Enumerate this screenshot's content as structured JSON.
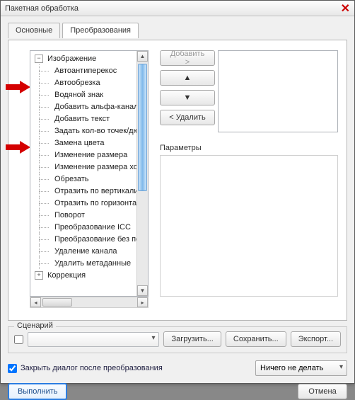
{
  "window": {
    "title": "Пакетная обработка"
  },
  "tabs": {
    "basic": "Основные",
    "transforms": "Преобразования"
  },
  "tree": {
    "group_image": "Изображение",
    "items": [
      "Автоантиперекос",
      "Автообрезка",
      "Водяной знак",
      "Добавить альфа-канал",
      "Добавить текст",
      "Задать кол-во точек/дюйм",
      "Замена цвета",
      "Изменение размера",
      "Изменение размера холста",
      "Обрезать",
      "Отразить по вертикали",
      "Отразить по горизонтали",
      "Поворот",
      "Преобразование ICC",
      "Преобразование без потерь",
      "Удаление канала",
      "Удалить метаданные"
    ],
    "group_correction": "Коррекция"
  },
  "buttons": {
    "add": "Добавить >",
    "delete": "< Удалить"
  },
  "params_label": "Параметры",
  "scenario": {
    "legend": "Сценарий",
    "load": "Загрузить...",
    "save": "Сохранить...",
    "export": "Экспорт..."
  },
  "close_after": "Закрыть диалог после преобразования",
  "action_combo": "Ничего не делать",
  "run": "Выполнить",
  "cancel": "Отмена"
}
